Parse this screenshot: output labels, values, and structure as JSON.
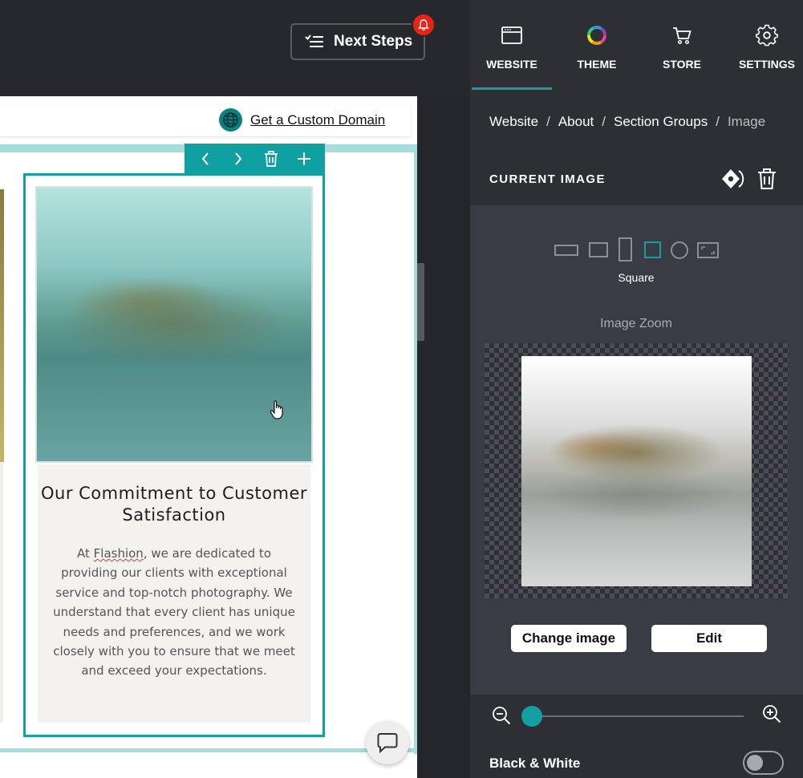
{
  "topbar": {
    "next_steps_label": "Next Steps"
  },
  "canvas": {
    "domain_link": "Get a Custom Domain",
    "card": {
      "title": "Our Commitment to Customer Satisfaction",
      "body_prefix": "At ",
      "body_brand": "Flashion",
      "body_rest": ", we are dedicated to providing our clients with exceptional service and top-notch photography. We understand that every client has unique needs and preferences, and we work closely with you to ensure that we meet and exceed your expectations."
    }
  },
  "panel": {
    "tabs": [
      {
        "label": "WEBSITE",
        "icon": "browser-window-icon",
        "active": true
      },
      {
        "label": "THEME",
        "icon": "color-wheel-icon",
        "active": false
      },
      {
        "label": "STORE",
        "icon": "shopping-cart-icon",
        "active": false
      },
      {
        "label": "SETTINGS",
        "icon": "gear-icon",
        "active": false
      }
    ],
    "breadcrumb": [
      "Website",
      "About",
      "Section Groups",
      "Image"
    ],
    "current_image_heading": "CURRENT IMAGE",
    "shape": {
      "options": [
        "panorama",
        "landscape",
        "portrait",
        "square",
        "circle",
        "original"
      ],
      "selected_label": "Square"
    },
    "zoom_heading": "Image Zoom",
    "buttons": {
      "change_image": "Change image",
      "edit": "Edit"
    },
    "zoom_level": 0,
    "black_white": {
      "label": "Black & White",
      "enabled": false
    }
  },
  "colors": {
    "accent": "#14a0a3",
    "notification": "#e8231a",
    "panel_bg": "#2d2f34"
  }
}
